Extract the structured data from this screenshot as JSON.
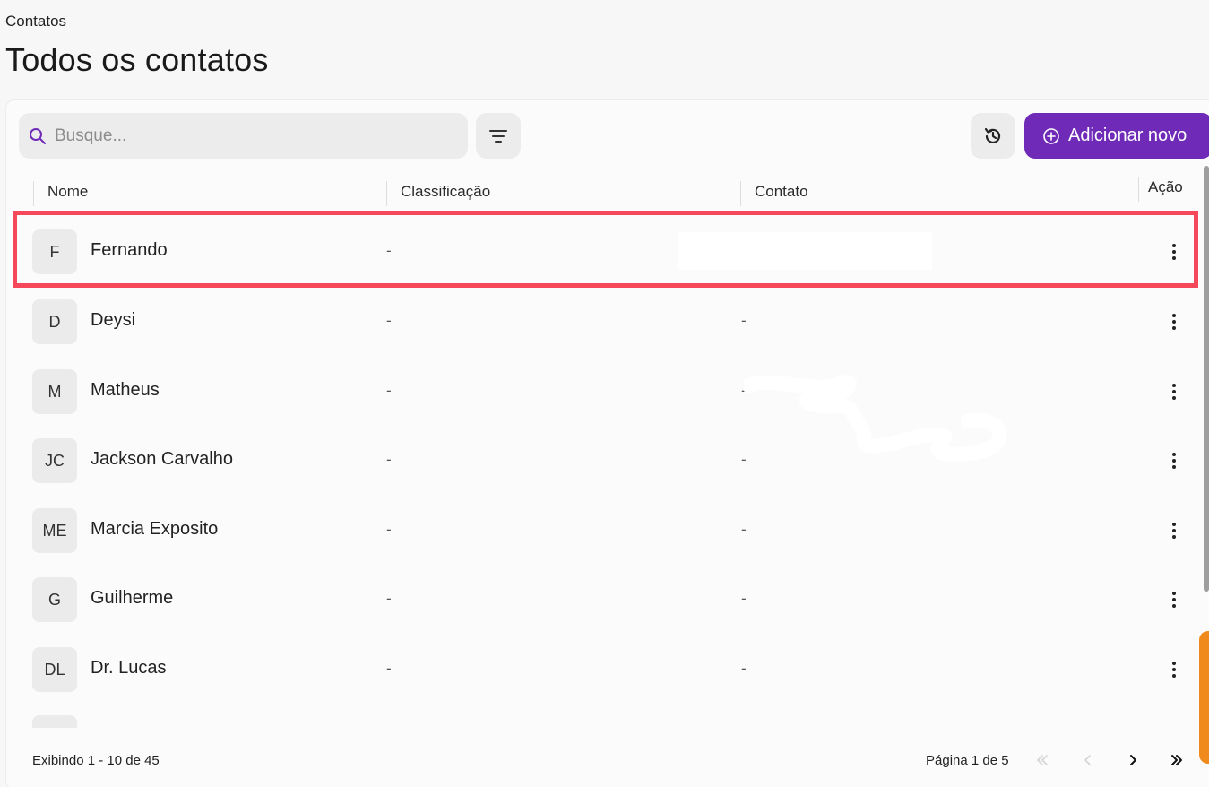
{
  "breadcrumb": "Contatos",
  "page_title": "Todos os contatos",
  "toolbar": {
    "search_placeholder": "Busque...",
    "add_label": "Adicionar novo"
  },
  "columns": {
    "name": "Nome",
    "classification": "Classificação",
    "contact": "Contato",
    "action": "Ação"
  },
  "contacts": [
    {
      "initials": "F",
      "name": "Fernando",
      "classification": "-",
      "contact": ""
    },
    {
      "initials": "D",
      "name": "Deysi",
      "classification": "-",
      "contact": "-"
    },
    {
      "initials": "M",
      "name": "Matheus",
      "classification": "-",
      "contact": "-"
    },
    {
      "initials": "JC",
      "name": "Jackson Carvalho",
      "classification": "-",
      "contact": "-"
    },
    {
      "initials": "ME",
      "name": "Marcia Exposito",
      "classification": "-",
      "contact": "-"
    },
    {
      "initials": "G",
      "name": "Guilherme",
      "classification": "-",
      "contact": "-"
    },
    {
      "initials": "DL",
      "name": "Dr. Lucas",
      "classification": "-",
      "contact": "-"
    }
  ],
  "footer": {
    "showing": "Exibindo 1 - 10 de 45",
    "page": "Página 1 de 5"
  },
  "colors": {
    "accent": "#6f2bb8",
    "highlight": "#f5485a",
    "side_tab": "#f08a1c"
  },
  "icons": {
    "search": "search-icon",
    "filter": "filter-icon",
    "history": "history-icon",
    "add": "plus-circle-icon",
    "more": "more-vertical-icon",
    "first": "chevrons-left-icon",
    "prev": "chevron-left-icon",
    "next": "chevron-right-icon",
    "last": "chevrons-right-icon"
  }
}
